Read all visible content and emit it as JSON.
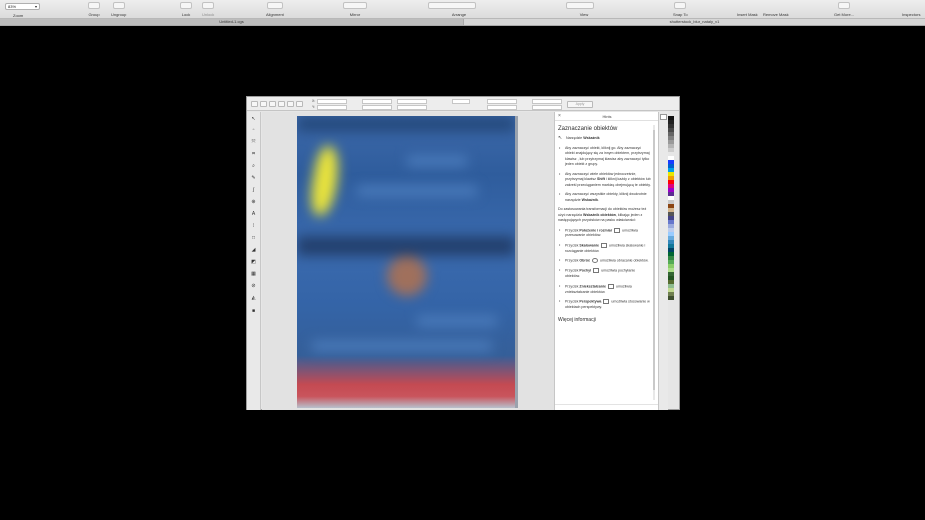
{
  "toolbar": {
    "zoom_value": "83%",
    "zoom_label": "Zoom",
    "items": [
      {
        "label": "Group",
        "dim": false
      },
      {
        "label": "Ungroup",
        "dim": false
      },
      {
        "label": "Lock",
        "dim": false
      },
      {
        "label": "Unlock",
        "dim": true
      },
      {
        "label": "Alignment",
        "dim": false
      },
      {
        "label": "Mirror",
        "dim": false
      },
      {
        "label": "Arrange",
        "dim": false
      },
      {
        "label": "View",
        "dim": false
      },
      {
        "label": "Snap To",
        "dim": false
      },
      {
        "label": "Insert Mask",
        "dim": false
      },
      {
        "label": "Remove Mask",
        "dim": false
      },
      {
        "label": "Get More...",
        "dim": false
      },
      {
        "label": "Inspectors",
        "dim": false
      }
    ]
  },
  "tabs": {
    "doc1": "Untitled-1.cgs",
    "doc2": "shutterstock_blur_nataly_v1"
  },
  "property_bar": {
    "rotate_button": "Apply"
  },
  "hints": {
    "title": "Hints",
    "heading": "Zaznaczanie obiektów",
    "tool_prefix": "Narzędzie",
    "tool_name": "Wskaźnik",
    "bullets_1": [
      "Aby zaznaczyć obiekt, kliknij go. Aby zaznaczyć obiekt znajdujący się za innym obiektem, przytrzymaj klawisz , lub przytrzymaj klawisz aby zaznaczyć tylko jeden obiekt z grupy.",
      "Aby zaznaczyć wiele obiektów jednocześnie, przytrzymaj klawisz",
      "Aby zaznaczyć wszystkie obiekty, kliknij dwukrotnie narzędzie"
    ],
    "bullet_2_key": "Shift",
    "bullet_2_rest": "i kliknij każdy z obiektów lub zakreśl przeciąganiem markizę obejmującą te obiekty.",
    "bullet_3_tool": "Wskaźnik",
    "para": "Do zastosowania transformacji do obiektów możesz też użyć narzędzia",
    "para_tool": "Wskaźnik obiektów",
    "para_rest": ", klikając jeden z następujących przycisków na pasku właściwości:",
    "buttons": [
      {
        "pre": "Przycisk",
        "name": "Położenie i rozmiar",
        "post": "umożliwia przesuwanie obiektów."
      },
      {
        "pre": "Przycisk",
        "name": "Skalowanie",
        "post": "umożliwia skalowanie i rozciąganie obiektów."
      },
      {
        "pre": "Przycisk",
        "name": "Obróć",
        "post": "umożliwia obracanie obiektów."
      },
      {
        "pre": "Przycisk",
        "name": "Pochyl",
        "post": "umożliwia pochylanie obiektów."
      },
      {
        "pre": "Przycisk",
        "name": "Zniekształcanie",
        "post": "umożliwia zniekształcanie obiektów."
      },
      {
        "pre": "Przycisk",
        "name": "Perspektywa",
        "post": "umożliwia stosowanie w obiektach perspektywy."
      }
    ],
    "more_info": "Więcej informacji"
  },
  "palette": {
    "colors": [
      "#111111",
      "#222222",
      "#333333",
      "#4a4a4a",
      "#666666",
      "#808080",
      "#999999",
      "#b3b3b3",
      "#cccccc",
      "#e6e6e6",
      "#ffffff",
      "#1a3cff",
      "#0060d0",
      "#00a0e8",
      "#e8e800",
      "#f0a000",
      "#ff0000",
      "#e0007a",
      "#9b00c8",
      "#5c2d91",
      "#ffffff",
      "#c8c8c8",
      "#8b4513",
      "#d2b48c",
      "#555555",
      "#444488",
      "#6677cc",
      "#99aadd",
      "#bbccee",
      "#99ccff",
      "#66aadd",
      "#3388bb",
      "#117799",
      "#004466",
      "#006633",
      "#338844",
      "#55aa55",
      "#88cc66",
      "#aadd88",
      "#336633",
      "#225522",
      "#556b2f",
      "#8fbc8f",
      "#c0d890",
      "#708050",
      "#405030"
    ]
  }
}
